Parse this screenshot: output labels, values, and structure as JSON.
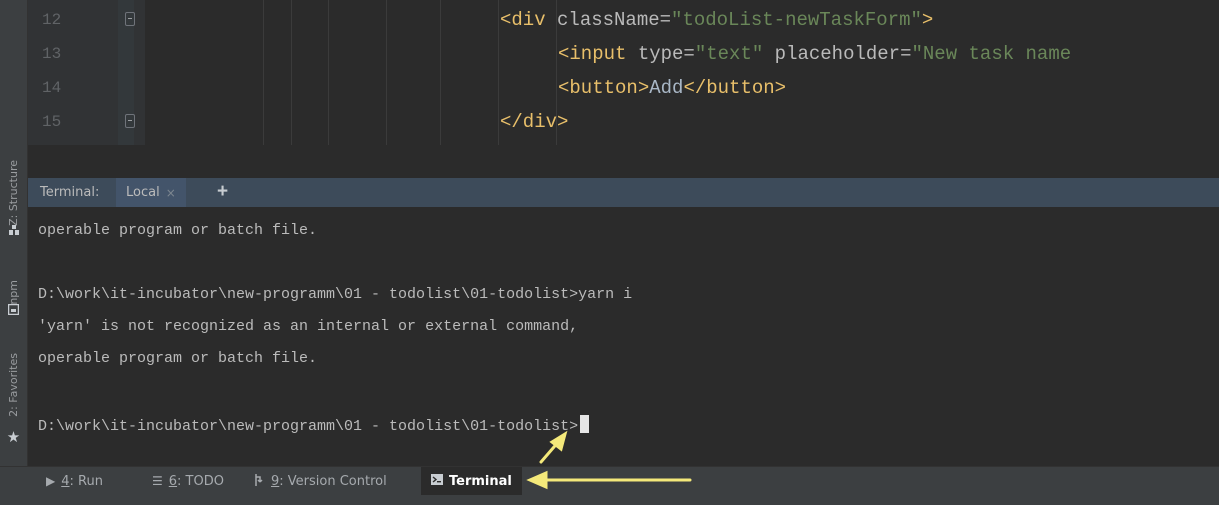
{
  "editor": {
    "lines": [
      {
        "num": "12",
        "open": "<div ",
        "attr": "className=",
        "str": "\"todoList-newTaskForm\"",
        "close": ">"
      },
      {
        "num": "13",
        "open": "<input ",
        "attr": "type=",
        "str": "\"text\"",
        "attr2": " placeholder=",
        "str2": "\"New task name"
      },
      {
        "num": "14",
        "open": "<button>",
        "plain": "Add",
        "close": "</button>"
      },
      {
        "num": "15",
        "open": "</div>"
      }
    ]
  },
  "sidebar": {
    "structure_label": "Z: Structure",
    "npm_label": "npm",
    "favorites_label": "2: Favorites"
  },
  "terminal": {
    "title": "Terminal:",
    "tab_label": "Local",
    "tab_close": "×",
    "add_tab": "+",
    "lines": [
      "operable program or batch file.",
      "",
      "D:\\work\\it-incubator\\new-programm\\01 - todolist\\01-todolist>yarn i",
      "'yarn' is not recognized as an internal or external command,",
      "operable program or batch file.",
      "",
      "D:\\work\\it-incubator\\new-programm\\01 - todolist\\01-todolist>"
    ]
  },
  "bottom_tabs": {
    "run": {
      "key": "4",
      "rest": ": Run"
    },
    "todo": {
      "key": "6",
      "rest": ": TODO"
    },
    "vcs": {
      "key": "9",
      "rest": ": Version Control"
    },
    "terminal": {
      "label": "Terminal"
    }
  },
  "colors": {
    "arrow": "#f4e97a",
    "tag": "#e8bf6a",
    "string": "#6a8759",
    "attribute": "#bababa"
  },
  "icons": [
    "fold-marker-icon",
    "close-icon",
    "plus-icon",
    "structure-icon",
    "npm-icon",
    "star-icon",
    "play-icon",
    "list-icon",
    "vcs-icon",
    "terminal-icon"
  ]
}
